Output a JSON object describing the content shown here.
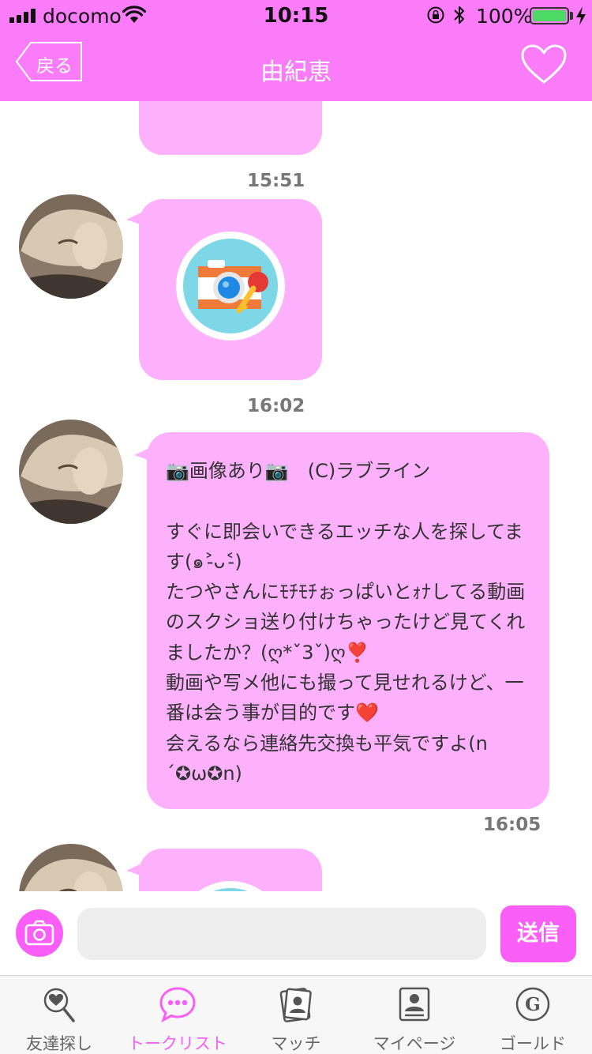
{
  "status_bar": {
    "carrier": "docomo",
    "time": "10:15",
    "battery_percent": "100%",
    "battery_level": 1.0
  },
  "nav": {
    "back_label": "戻る",
    "title": "由紀恵"
  },
  "messages": [
    {
      "type": "image",
      "timestamp": "15:51"
    },
    {
      "type": "image",
      "timestamp": "16:02"
    },
    {
      "type": "text",
      "timestamp": "16:05",
      "text": "📷画像あり📷　(C)ラブライン\n\nすぐに即会いできるエッチな人を探してます(๑˃̵ᴗ˂̵)\nたつやさんにﾓﾁﾓﾁぉっぱいとｫﾅしてる動画のスクショ送り付けちゃったけど見てくれましたか？(ღ*ˇ3ˇ)ღ❣️\n動画や写メ他にも撮って見せれるけど、一番は会う事が目的です❤️\n会えるなら連絡先交換も平気ですよ(n´✪ω✪n)"
    },
    {
      "type": "image"
    }
  ],
  "input": {
    "placeholder": "",
    "send_label": "送信"
  },
  "tabs": [
    {
      "label": "友達探し",
      "icon": "heart-search-icon",
      "active": false
    },
    {
      "label": "トークリスト",
      "icon": "chat-bubble-icon",
      "active": true
    },
    {
      "label": "マッチ",
      "icon": "match-cards-icon",
      "active": false
    },
    {
      "label": "マイページ",
      "icon": "profile-card-icon",
      "active": false
    },
    {
      "label": "ゴールド",
      "icon": "gold-coin-icon",
      "active": false
    }
  ],
  "colors": {
    "header": "#fb7cf8",
    "bubble": "#fdb1fc",
    "accent": "#f95ef7",
    "tab_active": "#f95ef7"
  }
}
